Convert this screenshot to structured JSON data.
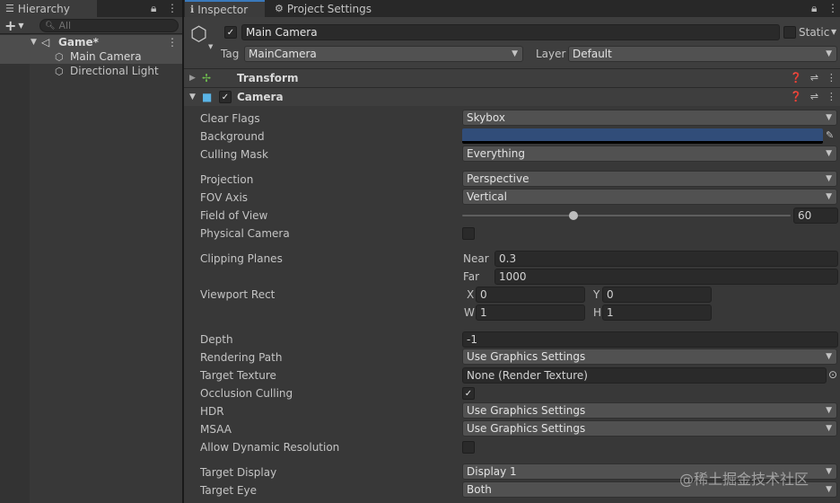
{
  "hierarchy": {
    "tab_label": "Hierarchy",
    "search_placeholder": "All",
    "add_label": "+",
    "scene_name": "Game*",
    "items": [
      "Main Camera",
      "Directional Light"
    ]
  },
  "tabs": {
    "inspector": "Inspector",
    "project_settings": "Project Settings"
  },
  "object": {
    "name": "Main Camera",
    "static_label": "Static",
    "tag_label": "Tag",
    "tag_value": "MainCamera",
    "layer_label": "Layer",
    "layer_value": "Default"
  },
  "components": {
    "transform": "Transform",
    "camera": "Camera"
  },
  "camera": {
    "clear_flags": {
      "label": "Clear Flags",
      "value": "Skybox"
    },
    "background": {
      "label": "Background",
      "color": "#314D79"
    },
    "culling_mask": {
      "label": "Culling Mask",
      "value": "Everything"
    },
    "projection": {
      "label": "Projection",
      "value": "Perspective"
    },
    "fov_axis": {
      "label": "FOV Axis",
      "value": "Vertical"
    },
    "field_of_view": {
      "label": "Field of View",
      "value": "60",
      "fraction": 0.34
    },
    "physical_camera": {
      "label": "Physical Camera",
      "checked": false
    },
    "clipping_planes": {
      "label": "Clipping Planes",
      "near_label": "Near",
      "near": "0.3",
      "far_label": "Far",
      "far": "1000"
    },
    "viewport_rect": {
      "label": "Viewport Rect",
      "x_label": "X",
      "x": "0",
      "y_label": "Y",
      "y": "0",
      "w_label": "W",
      "w": "1",
      "h_label": "H",
      "h": "1"
    },
    "depth": {
      "label": "Depth",
      "value": "-1"
    },
    "rendering_path": {
      "label": "Rendering Path",
      "value": "Use Graphics Settings"
    },
    "target_texture": {
      "label": "Target Texture",
      "value": "None (Render Texture)"
    },
    "occlusion_culling": {
      "label": "Occlusion Culling",
      "checked": true
    },
    "hdr": {
      "label": "HDR",
      "value": "Use Graphics Settings"
    },
    "msaa": {
      "label": "MSAA",
      "value": "Use Graphics Settings"
    },
    "allow_dynamic_resolution": {
      "label": "Allow Dynamic Resolution",
      "checked": false
    },
    "target_display": {
      "label": "Target Display",
      "value": "Display 1"
    },
    "target_eye": {
      "label": "Target Eye",
      "value": "Both"
    }
  },
  "watermark": "@稀土掘金技术社区",
  "colors": {
    "accent": "#3A79BB",
    "selection": "#4D4D4D"
  }
}
